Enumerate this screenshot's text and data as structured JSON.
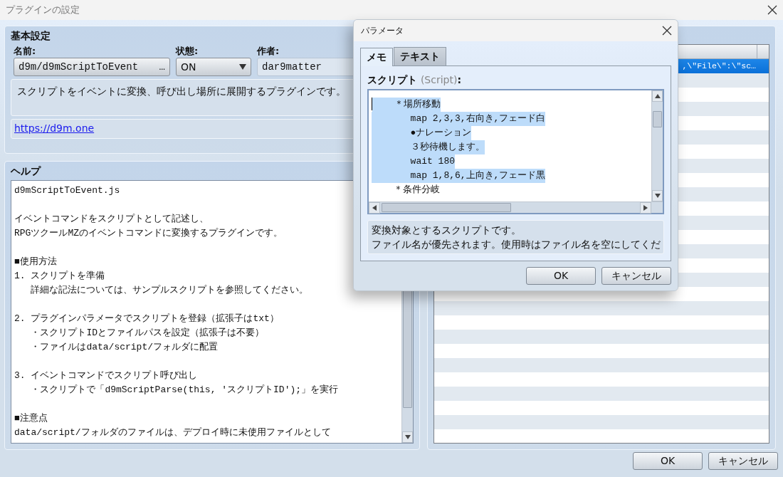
{
  "window": {
    "title": "プラグインの設定"
  },
  "basic": {
    "heading": "基本設定",
    "name_label": "名前:",
    "name_value": "d9m/d9mScriptToEvent",
    "name_button": "…",
    "status_label": "状態:",
    "status_value": "ON",
    "author_label": "作者:",
    "author_value": "dar9matter",
    "description": "スクリプトをイベントに変換、呼び出し場所に展開するプラグインです。",
    "url": "https://d9m.one"
  },
  "help": {
    "heading": "ヘルプ",
    "paragraphs": [
      [
        "d9mScriptToEvent.js"
      ],
      [
        "イベントコマンドをスクリプトとして記述し、",
        "RPGツクールMZのイベントコマンドに変換するプラグインです。"
      ],
      [
        "■使用方法",
        "1. スクリプトを準備",
        "   詳細な記法については、サンプルスクリプトを参照してください。"
      ],
      [
        "2. プラグインパラメータでスクリプトを登録（拡張子はtxt）",
        "   ・スクリプトIDとファイルパスを設定（拡張子は不要）",
        "   ・ファイルはdata/script/フォルダに配置"
      ],
      [
        "3. イベントコマンドでスクリプト呼び出し",
        "   ・スクリプトで「d9mScriptParse(this, 'スクリプトID');」を実行"
      ],
      [
        "■注意点",
        "data/script/フォルダのファイルは、デプロイ時に未使用ファイルとして"
      ]
    ]
  },
  "list": {
    "rows": [
      {
        "text": ",\\\"File\\\":\\\"sc…",
        "selected": true
      }
    ]
  },
  "dialog": {
    "title": "パラメータ",
    "tabs": [
      {
        "label": "メモ",
        "selected": true
      },
      {
        "label": "テキスト",
        "selected": false
      }
    ],
    "field_label": "スクリプト",
    "field_hint": "(Script)",
    "field_suffix": ":",
    "script_lines": [
      {
        "text": "    ＊場所移動",
        "selected": true
      },
      {
        "text": "       map 2,3,3,右向き,フェード白",
        "selected": true
      },
      {
        "text": "       ●ナレーション",
        "selected": true
      },
      {
        "text": "       ３秒待機します。",
        "selected": true
      },
      {
        "text": "       wait 180",
        "selected": true
      },
      {
        "text": "       map 1,8,6,上向き,フェード黒",
        "selected": true
      },
      {
        "text": "    ＊条件分岐",
        "selected": false
      }
    ],
    "description": [
      "変換対象とするスクリプトです。",
      "ファイル名が優先されます。使用時はファイル名を空にしてくだ"
    ],
    "buttons": [
      {
        "label": "OK"
      },
      {
        "label": "キャンセル"
      }
    ]
  },
  "buttons": [
    {
      "label": "OK"
    },
    {
      "label": "キャンセル"
    }
  ]
}
